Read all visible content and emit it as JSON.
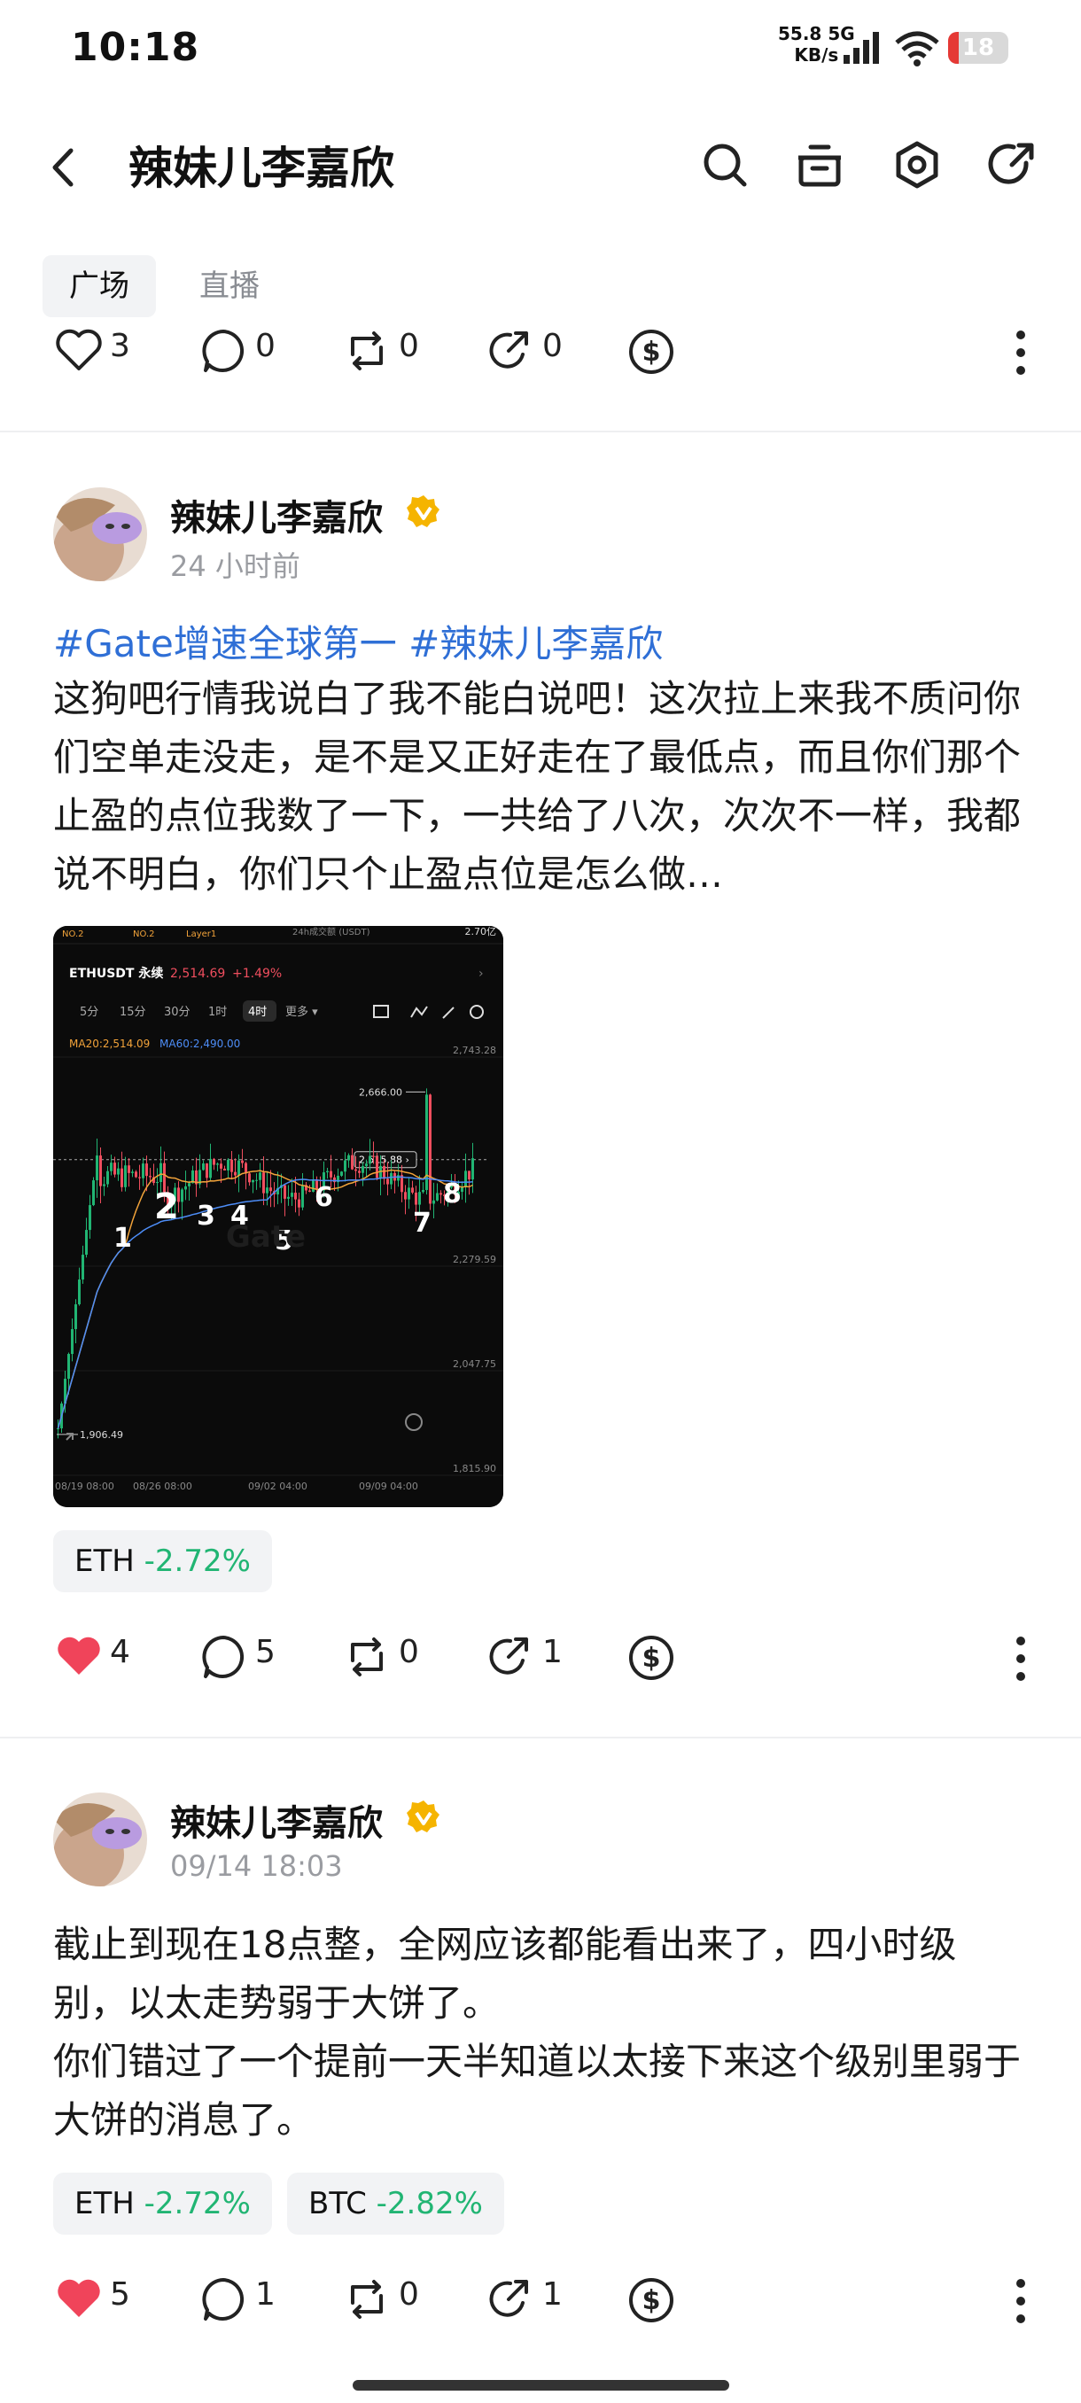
{
  "status_bar": {
    "time": "10:18",
    "net_speed_value": "55.8",
    "net_type": "5G",
    "net_speed_unit": "KB/s",
    "battery_level": "18",
    "battery_fraction": 0.18
  },
  "header": {
    "title": "辣妹儿李嘉欣",
    "icons": [
      "back-icon",
      "search-icon",
      "gift-icon",
      "settings-icon",
      "share-icon"
    ]
  },
  "tabs": [
    {
      "label": "广场",
      "active": true
    },
    {
      "label": "直播",
      "active": false
    }
  ],
  "top_actions": {
    "like_count": "3",
    "comment_count": "0",
    "repost_count": "0",
    "share_count": "0"
  },
  "posts": [
    {
      "author": "辣妹儿李嘉欣",
      "time": "24 小时前",
      "hashtags": "#Gate增速全球第一 #辣妹儿李嘉欣",
      "text": "这狗吧行情我说白了我不能白说吧！这次拉上来我不质问你们空单走没走，是不是又正好走在了最低点，而且你们那个止盈的点位我数了一下，一共给了八次，次次不一样，我都说不明白，你们只个止盈点位是怎么做…",
      "chart": {
        "tab_no2": "NO.2",
        "tab_no2b": "NO.2",
        "tab_layer": "Layer1",
        "vol_label": "24h成交额 (USDT)",
        "vol_value": "2.70亿",
        "pair": "ETHUSDT 永续",
        "price": "2,514.69",
        "change": "+1.49%",
        "timeframes": [
          "5分",
          "15分",
          "30分",
          "1时",
          "4时",
          "更多 ▾"
        ],
        "ma20": "MA20:2,514.09",
        "ma60": "MA60:2,490.00",
        "y_ticks": [
          "2,743.28",
          "2,279.59",
          "2,047.75",
          "1,815.90"
        ],
        "x_ticks": [
          "08/19 08:00",
          "08/26 08:00",
          "09/02 04:00",
          "09/09 04:00"
        ],
        "high_label": "2,666.00",
        "current_label": "2,515.88 ›",
        "low_label": "1,906.49",
        "watermark": "Gate",
        "annotations": [
          "1",
          "2",
          "3",
          "4",
          "5",
          "6",
          "7",
          "8"
        ]
      },
      "coins": [
        {
          "symbol": "ETH",
          "change": "-2.72%"
        }
      ],
      "actions": {
        "like_count": "4",
        "comment_count": "5",
        "repost_count": "0",
        "share_count": "1"
      },
      "liked": true
    },
    {
      "author": "辣妹儿李嘉欣",
      "time": "09/14 18:03",
      "text_lines": [
        "截止到现在18点整，全网应该都能看出来了，四小时级别，以太走势弱于大饼了。",
        "你们错过了一个提前一天半知道以太接下来这个级别里弱于大饼的消息了。"
      ],
      "coins": [
        {
          "symbol": "ETH",
          "change": "-2.72%"
        },
        {
          "symbol": "BTC",
          "change": "-2.82%"
        }
      ],
      "actions": {
        "like_count": "5",
        "comment_count": "1",
        "repost_count": "0",
        "share_count": "1"
      },
      "liked": true
    }
  ],
  "colors": {
    "accent_link": "#2f6fd6",
    "gain_green": "#21b573",
    "like_red": "#f0445a",
    "verified_gold": "#f5b400",
    "battery_red": "#e53935"
  }
}
